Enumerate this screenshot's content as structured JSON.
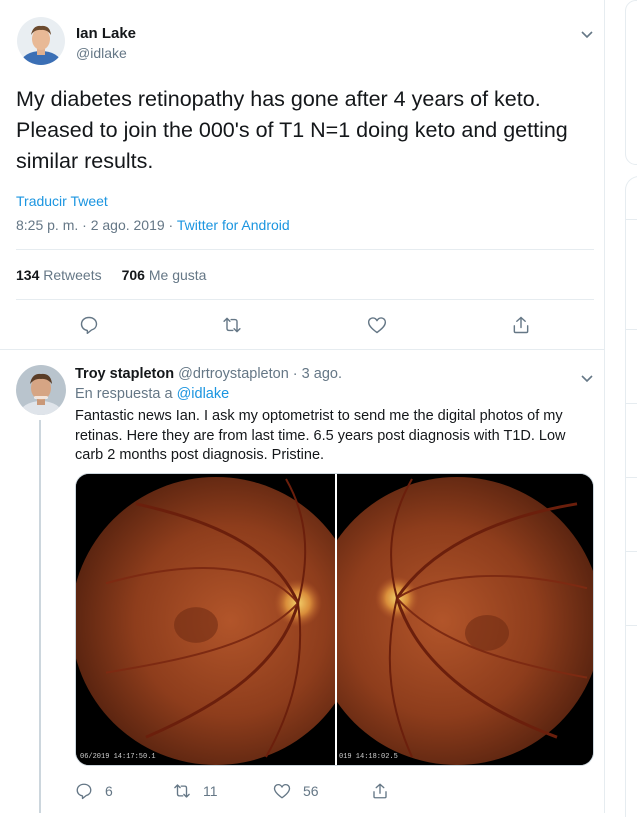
{
  "main_tweet": {
    "author_name": "Ian Lake",
    "author_handle": "@idlake",
    "text": "My diabetes retinopathy has gone after 4 years of keto. Pleased to join the 000's of T1 N=1 doing keto and getting similar results.",
    "translate_label": "Traducir Tweet",
    "timestamp": "8:25 p. m. · 2 ago. 2019 · ",
    "source": "Twitter for Android",
    "retweets_count": "134",
    "retweets_label": "Retweets",
    "likes_count": "706",
    "likes_label": "Me gusta",
    "actions": [
      "reply-icon",
      "retweet-icon",
      "like-icon",
      "share-icon"
    ]
  },
  "reply": {
    "author_name": "Troy stapleton",
    "author_meta": "@drtroystapleton · 3 ago.",
    "reply_to_prefix": "En respuesta a ",
    "reply_to_handle": "@idlake",
    "text": "Fantastic news Ian. I ask my optometrist to send me the digital photos of my retinas. Here they are from last time.  6.5 years post diagnosis with T1D. Low carb 2 months post diagnosis. Pristine.",
    "image_left_stamp": "06/2019  14:17:50.1",
    "image_right_stamp": "019  14:18:02.5",
    "reply_count": "6",
    "retweet_count": "11",
    "like_count": "56"
  },
  "colors": {
    "accent": "#1b95e0",
    "secondary_text": "#657786",
    "divider": "#e6ecf0"
  }
}
